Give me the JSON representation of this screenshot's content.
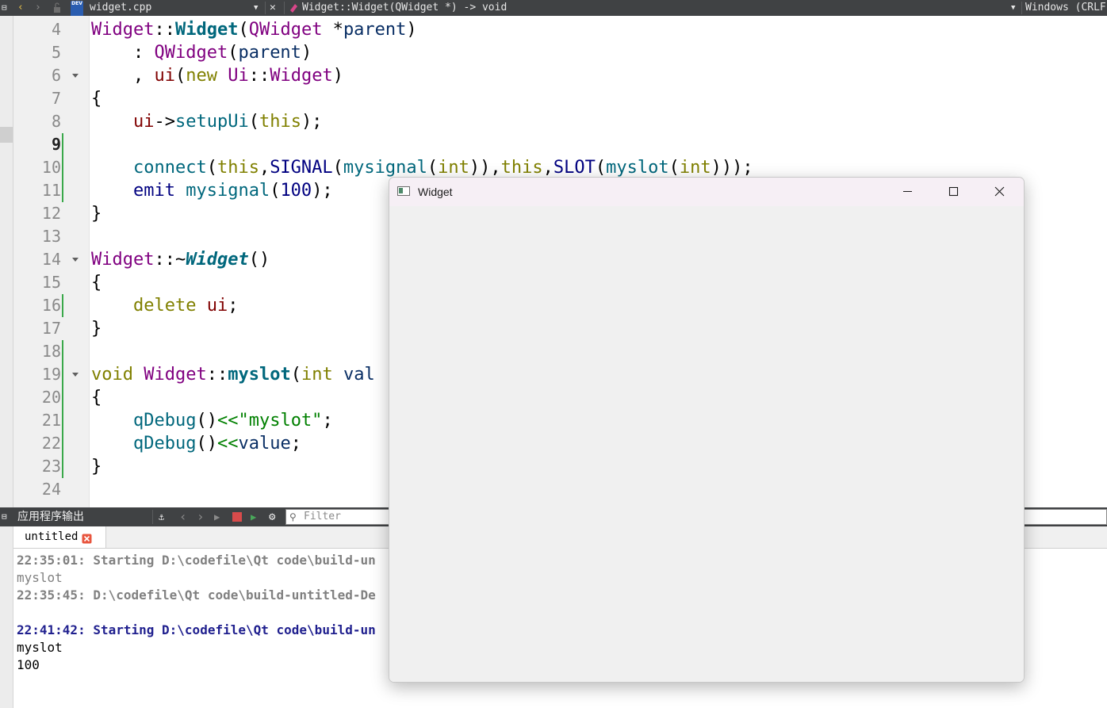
{
  "toolbar": {
    "file_name": "widget.cpp",
    "function_scope": "Widget::Widget(QWidget *) -> void",
    "line_endings": "Windows (CRLF)",
    "logo_text": "DEV"
  },
  "editor": {
    "current_line": 9,
    "lines": [
      {
        "num": 4,
        "tokens": [
          {
            "t": "Widget",
            "c": "k-type"
          },
          {
            "t": "::",
            "c": ""
          },
          {
            "t": "Widget",
            "c": "k-fn"
          },
          {
            "t": "(",
            "c": ""
          },
          {
            "t": "QWidget",
            "c": "k-type"
          },
          {
            "t": " *",
            "c": ""
          },
          {
            "t": "parent",
            "c": "k-par"
          },
          {
            "t": ")",
            "c": ""
          }
        ]
      },
      {
        "num": 5,
        "tokens": [
          {
            "t": "    : ",
            "c": ""
          },
          {
            "t": "QWidget",
            "c": "k-type"
          },
          {
            "t": "(",
            "c": ""
          },
          {
            "t": "parent",
            "c": "k-par"
          },
          {
            "t": ")",
            "c": ""
          }
        ]
      },
      {
        "num": 6,
        "tokens": [
          {
            "t": "    , ",
            "c": ""
          },
          {
            "t": "ui",
            "c": "k-mem"
          },
          {
            "t": "(",
            "c": ""
          },
          {
            "t": "new",
            "c": "k-kw"
          },
          {
            "t": " ",
            "c": ""
          },
          {
            "t": "Ui",
            "c": "k-type"
          },
          {
            "t": "::",
            "c": ""
          },
          {
            "t": "Widget",
            "c": "k-type"
          },
          {
            "t": ")",
            "c": ""
          }
        ]
      },
      {
        "num": 7,
        "tokens": [
          {
            "t": "{",
            "c": ""
          }
        ]
      },
      {
        "num": 8,
        "tokens": [
          {
            "t": "    ",
            "c": ""
          },
          {
            "t": "ui",
            "c": "k-mem"
          },
          {
            "t": "->",
            "c": ""
          },
          {
            "t": "setupUi",
            "c": "k-call"
          },
          {
            "t": "(",
            "c": ""
          },
          {
            "t": "this",
            "c": "k-kw"
          },
          {
            "t": ");",
            "c": ""
          }
        ]
      },
      {
        "num": 9,
        "tokens": []
      },
      {
        "num": 10,
        "tokens": [
          {
            "t": "    ",
            "c": ""
          },
          {
            "t": "connect",
            "c": "k-call"
          },
          {
            "t": "(",
            "c": ""
          },
          {
            "t": "this",
            "c": "k-kw"
          },
          {
            "t": ",",
            "c": ""
          },
          {
            "t": "SIGNAL",
            "c": "k-mac"
          },
          {
            "t": "(",
            "c": ""
          },
          {
            "t": "mysignal",
            "c": "k-call"
          },
          {
            "t": "(",
            "c": ""
          },
          {
            "t": "int",
            "c": "k-kw"
          },
          {
            "t": ")),",
            "c": ""
          },
          {
            "t": "this",
            "c": "k-kw"
          },
          {
            "t": ",",
            "c": ""
          },
          {
            "t": "SLOT",
            "c": "k-mac"
          },
          {
            "t": "(",
            "c": ""
          },
          {
            "t": "myslot",
            "c": "k-call"
          },
          {
            "t": "(",
            "c": ""
          },
          {
            "t": "int",
            "c": "k-kw"
          },
          {
            "t": ")));",
            "c": ""
          }
        ]
      },
      {
        "num": 11,
        "tokens": [
          {
            "t": "    ",
            "c": ""
          },
          {
            "t": "emit",
            "c": "k-mac"
          },
          {
            "t": " ",
            "c": ""
          },
          {
            "t": "mysignal",
            "c": "k-call"
          },
          {
            "t": "(",
            "c": ""
          },
          {
            "t": "100",
            "c": "k-num"
          },
          {
            "t": ");",
            "c": ""
          }
        ]
      },
      {
        "num": 12,
        "tokens": [
          {
            "t": "}",
            "c": ""
          }
        ]
      },
      {
        "num": 13,
        "tokens": []
      },
      {
        "num": 14,
        "tokens": [
          {
            "t": "Widget",
            "c": "k-type"
          },
          {
            "t": "::~",
            "c": ""
          },
          {
            "t": "Widget",
            "c": "k-fni"
          },
          {
            "t": "()",
            "c": ""
          }
        ]
      },
      {
        "num": 15,
        "tokens": [
          {
            "t": "{",
            "c": ""
          }
        ]
      },
      {
        "num": 16,
        "tokens": [
          {
            "t": "    ",
            "c": ""
          },
          {
            "t": "delete",
            "c": "k-kw"
          },
          {
            "t": " ",
            "c": ""
          },
          {
            "t": "ui",
            "c": "k-mem"
          },
          {
            "t": ";",
            "c": ""
          }
        ]
      },
      {
        "num": 17,
        "tokens": [
          {
            "t": "}",
            "c": ""
          }
        ]
      },
      {
        "num": 18,
        "tokens": []
      },
      {
        "num": 19,
        "tokens": [
          {
            "t": "void",
            "c": "k-kw"
          },
          {
            "t": " ",
            "c": ""
          },
          {
            "t": "Widget",
            "c": "k-type"
          },
          {
            "t": "::",
            "c": ""
          },
          {
            "t": "myslot",
            "c": "k-fn"
          },
          {
            "t": "(",
            "c": ""
          },
          {
            "t": "int",
            "c": "k-kw"
          },
          {
            "t": " val",
            "c": "k-par"
          }
        ]
      },
      {
        "num": 20,
        "tokens": [
          {
            "t": "{",
            "c": ""
          }
        ]
      },
      {
        "num": 21,
        "tokens": [
          {
            "t": "    ",
            "c": ""
          },
          {
            "t": "qDebug",
            "c": "k-call"
          },
          {
            "t": "()",
            "c": ""
          },
          {
            "t": "<<",
            "c": "k-str"
          },
          {
            "t": "\"myslot\"",
            "c": "k-str"
          },
          {
            "t": ";",
            "c": ""
          }
        ]
      },
      {
        "num": 22,
        "tokens": [
          {
            "t": "    ",
            "c": ""
          },
          {
            "t": "qDebug",
            "c": "k-call"
          },
          {
            "t": "()",
            "c": ""
          },
          {
            "t": "<<",
            "c": "k-str"
          },
          {
            "t": "value",
            "c": "k-par"
          },
          {
            "t": ";",
            "c": ""
          }
        ]
      },
      {
        "num": 23,
        "tokens": [
          {
            "t": "}",
            "c": ""
          }
        ]
      },
      {
        "num": 24,
        "tokens": []
      }
    ]
  },
  "output_pane": {
    "title": "应用程序输出",
    "filter_placeholder": "Filter",
    "tab_label": "untitled",
    "lines": [
      {
        "text": "22:35:01: Starting D:\\codefile\\Qt code\\build-un",
        "style": "o-grey"
      },
      {
        "text": "myslot",
        "style": "o-greyn"
      },
      {
        "text": "22:35:45: D:\\codefile\\Qt code\\build-untitled-De",
        "style": "o-grey"
      },
      {
        "text": "",
        "style": "o-black"
      },
      {
        "text": "22:41:42: Starting D:\\codefile\\Qt code\\build-un",
        "style": "o-blue"
      },
      {
        "text": "myslot",
        "style": "o-black"
      },
      {
        "text": "100",
        "style": "o-black"
      }
    ]
  },
  "window": {
    "title": "Widget"
  }
}
